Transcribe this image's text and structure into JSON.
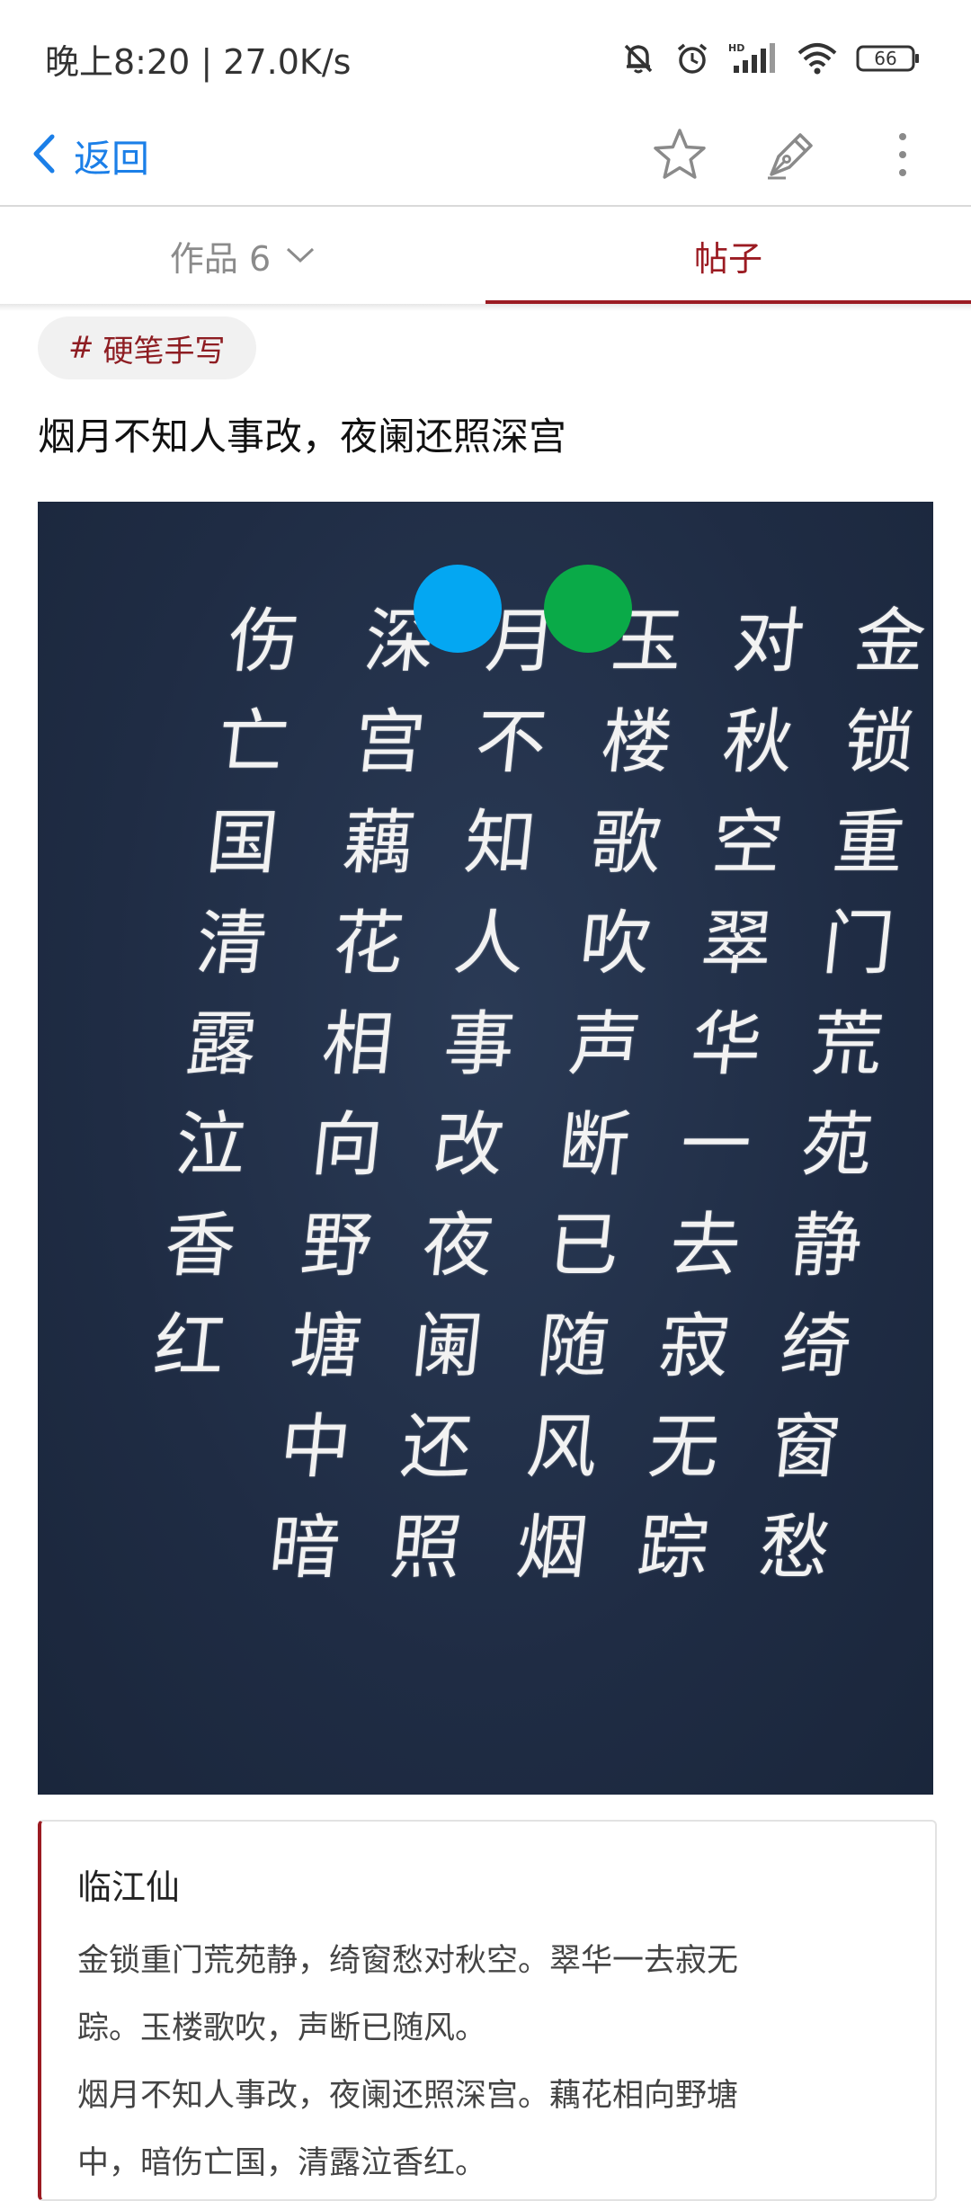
{
  "status_bar": {
    "time": "晚上8:20 | 27.0K/s",
    "battery": "66",
    "icons": [
      "mute-bell-icon",
      "alarm-icon",
      "hd-signal-icon",
      "wifi-icon",
      "battery-icon"
    ]
  },
  "header": {
    "back_label": "返回",
    "icons": [
      "star-icon",
      "pen-icon",
      "more-vertical-icon"
    ]
  },
  "tabs": {
    "works_label": "作品 6",
    "posts_label": "帖子",
    "active": "帖子",
    "accent_color": "#9b1b22"
  },
  "post": {
    "tag": "硬笔手写",
    "title": "烟月不知人事改，夜阑还照深宫"
  },
  "artwork": {
    "columns": [
      "金锁重门荒苑静绮窗愁",
      "对秋空翠华一去寂无踪",
      "玉楼歌吹声断已随风烟",
      "月不知人事改夜阑还照",
      "深宫藕花相向野塘中暗",
      "伤亡国清露泣香红"
    ]
  },
  "poem": {
    "title": "临江仙",
    "lines": [
      "金锁重门荒苑静，绮窗愁对秋空。翠华一去寂无",
      "踪。玉楼歌吹，声断已随风。",
      "烟月不知人事改，夜阑还照深宫。藕花相向野塘",
      "中，暗伤亡国，清露泣香红。"
    ]
  }
}
